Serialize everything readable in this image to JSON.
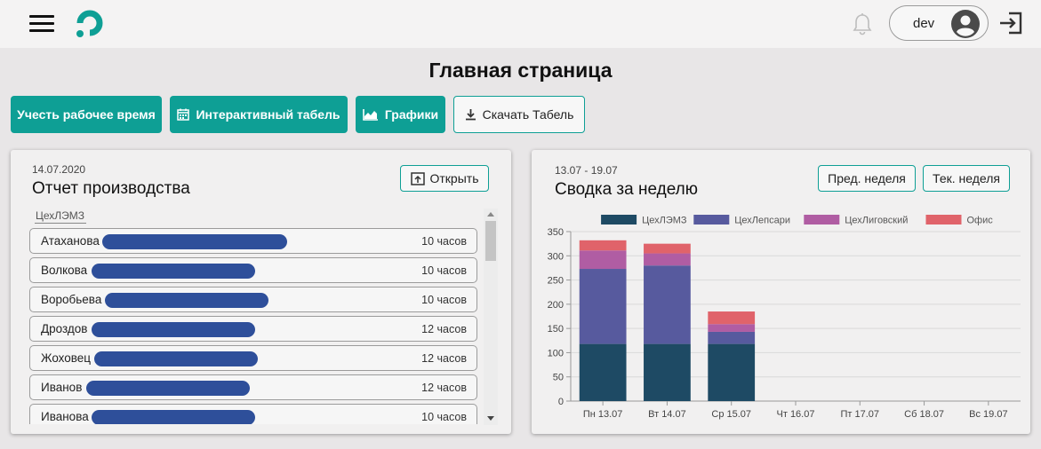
{
  "header": {
    "user_name": "dev",
    "icons": [
      "menu-icon",
      "app-logo",
      "bell-icon",
      "account-icon",
      "logout-icon"
    ]
  },
  "page_title": "Главная страница",
  "actions": {
    "track_time": "Учесть рабочее время",
    "interactive_timesheet": "Интерактивный табель",
    "charts": "Графики",
    "download_timesheet": "Скачать Табель"
  },
  "report": {
    "date": "14.07.2020",
    "title": "Отчет производства",
    "open_label": "Открыть",
    "group": "ЦехЛЭМЗ",
    "rows": [
      {
        "name": "Атаханова",
        "hours": "10 часов"
      },
      {
        "name": "Волкова",
        "hours": "10 часов"
      },
      {
        "name": "Воробьева",
        "hours": "10 часов"
      },
      {
        "name": "Дроздов",
        "hours": "12 часов"
      },
      {
        "name": "Жоховец",
        "hours": "12 часов"
      },
      {
        "name": "Иванов",
        "hours": "12 часов"
      },
      {
        "name": "Иванова",
        "hours": "10 часов"
      }
    ]
  },
  "summary": {
    "range": "13.07 - 19.07",
    "title": "Сводка за неделю",
    "prev_week": "Пред. неделя",
    "current_week": "Тек. неделя"
  },
  "colors": {
    "accent": "#0e9f95",
    "redaction": "#2e4f9a"
  },
  "chart_data": {
    "type": "bar",
    "stacked": true,
    "categories": [
      "Пн 13.07",
      "Вт 14.07",
      "Ср 15.07",
      "Чт 16.07",
      "Пт 17.07",
      "Сб 18.07",
      "Вс 19.07"
    ],
    "series": [
      {
        "name": "ЦехЛЭМЗ",
        "color": "#1e4a64",
        "values": [
          118,
          118,
          118,
          0,
          0,
          0,
          0
        ]
      },
      {
        "name": "ЦехЛепсари",
        "color": "#575a9e",
        "values": [
          155,
          162,
          25,
          0,
          0,
          0,
          0
        ]
      },
      {
        "name": "ЦехЛиговский",
        "color": "#b05da3",
        "values": [
          38,
          25,
          16,
          0,
          0,
          0,
          0
        ]
      },
      {
        "name": "Офис",
        "color": "#e0636a",
        "values": [
          21,
          20,
          26,
          0,
          0,
          0,
          0
        ]
      }
    ],
    "yticks": [
      "0",
      "50",
      "100",
      "150",
      "200",
      "250",
      "300",
      "350"
    ],
    "ylim": [
      0,
      350
    ],
    "grid": true,
    "legend_position": "top"
  }
}
